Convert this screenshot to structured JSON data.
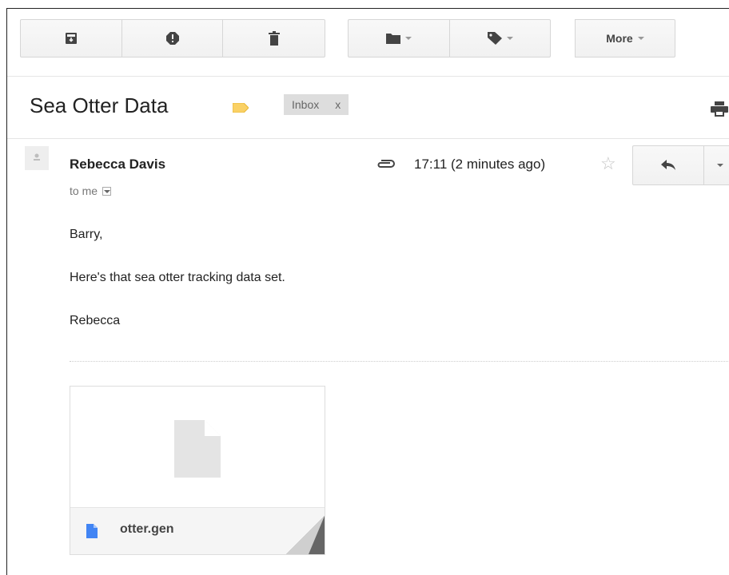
{
  "toolbar": {
    "archive_icon": "archive-icon",
    "spam_icon": "report-spam-icon",
    "delete_icon": "trash-icon",
    "move_icon": "folder-icon",
    "labels_icon": "tag-icon",
    "more_label": "More"
  },
  "thread": {
    "subject": "Sea Otter Data",
    "label_color": "#fad165",
    "inbox_chip": "Inbox",
    "inbox_remove": "x"
  },
  "message": {
    "sender": "Rebecca Davis",
    "to_line": "to me",
    "timestamp": "17:11 (2 minutes ago)",
    "star": "☆",
    "body": [
      "Barry,",
      "Here's that sea otter tracking data set.",
      "Rebecca"
    ]
  },
  "attachment": {
    "file_name": "otter.gen",
    "file_icon_color": "#4285f4"
  }
}
